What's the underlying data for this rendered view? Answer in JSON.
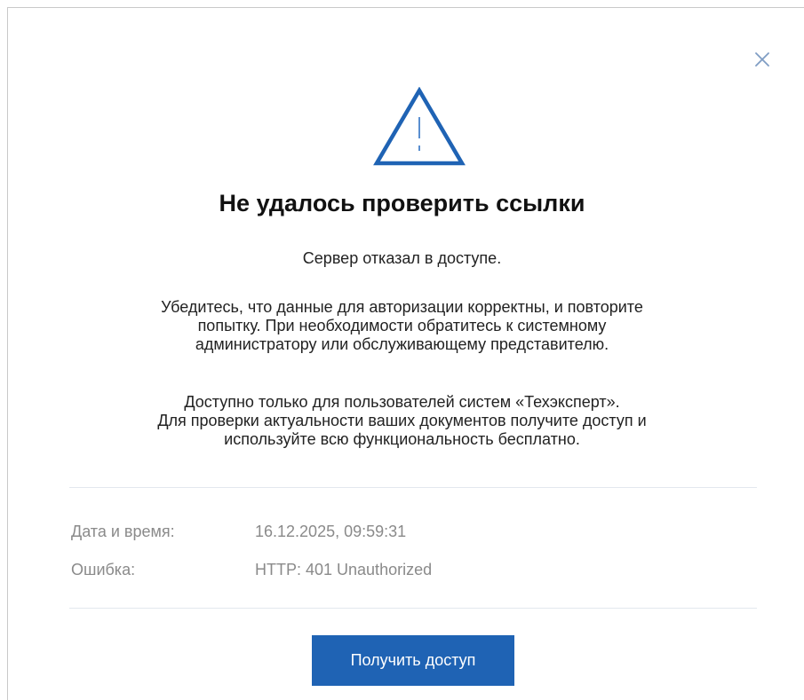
{
  "dialog": {
    "title": "Не удалось проверить ссылки",
    "message_1": "Сервер отказал в доступе.",
    "message_2": "Убедитесь, что данные для авторизации корректны, и повторите\nпопытку. При необходимости обратитесь к системному\nадминистратору или обслуживающему представителю.",
    "message_3": "Доступно только для пользователей систем «Техэксперт».\nДля проверки актуальности ваших документов получите доступ и\nиспользуйте всю функциональность бесплатно.",
    "details": {
      "date_label": "Дата и время:",
      "date_value": "16.12.2025, 09:59:31",
      "error_label": "Ошибка:",
      "error_value": "HTTP: 401 Unauthorized"
    },
    "button_label": "Получить доступ",
    "icons": {
      "close": "close-icon",
      "warning": "warning-triangle-icon"
    }
  },
  "colors": {
    "accent": "#1f63b4",
    "warning_icon": "#1f63b4",
    "close_icon": "#7f9dc4",
    "muted_text": "#8a8a8a",
    "divider": "#e3e8ee"
  }
}
